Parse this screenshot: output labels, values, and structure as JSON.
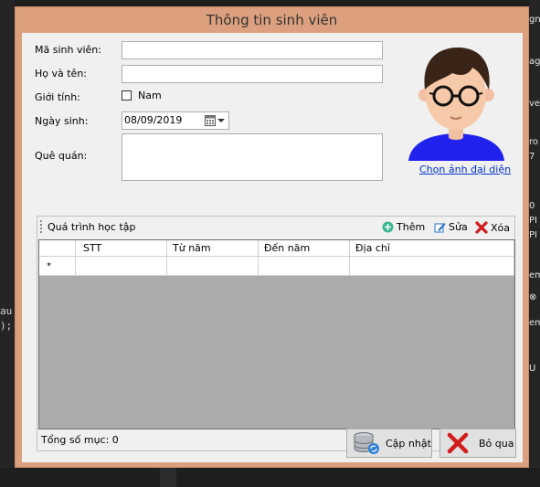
{
  "window": {
    "title": "Thông tin sinh viên"
  },
  "form": {
    "student_id_label": "Mã sinh viên:",
    "student_id_value": "",
    "name_label": "Họ và tên:",
    "name_value": "",
    "gender_label": "Giới tính:",
    "gender_checkbox_label": "Nam",
    "gender_checked": false,
    "birth_label": "Ngày sinh:",
    "birth_value": "08/09/2019",
    "hometown_label": "Quê quán:",
    "hometown_value": ""
  },
  "avatar": {
    "choose_link": "Chọn ảnh đại diện"
  },
  "history": {
    "title": "Quá trình học tập",
    "add_label": "Thêm",
    "edit_label": "Sửa",
    "delete_label": "Xóa",
    "columns": [
      "STT",
      "Từ năm",
      "Đến năm",
      "Địa chỉ"
    ],
    "new_row_marker": "*",
    "status_text": "Tổng số mục: 0"
  },
  "buttons": {
    "update_label": "Cập nhật",
    "cancel_label": "Bỏ qua"
  },
  "background": {
    "code_left_1": "au",
    "code_left_2": ");",
    "right_fragments": [
      "gn",
      "ag",
      "ve",
      "ro",
      "7",
      "0",
      "PI",
      "PI",
      "em",
      "⊗",
      "em",
      "U"
    ]
  },
  "colors": {
    "title_bar": "#dca07e",
    "client": "#f0f0f0",
    "grid_empty": "#ababab",
    "link": "#0033cc"
  }
}
